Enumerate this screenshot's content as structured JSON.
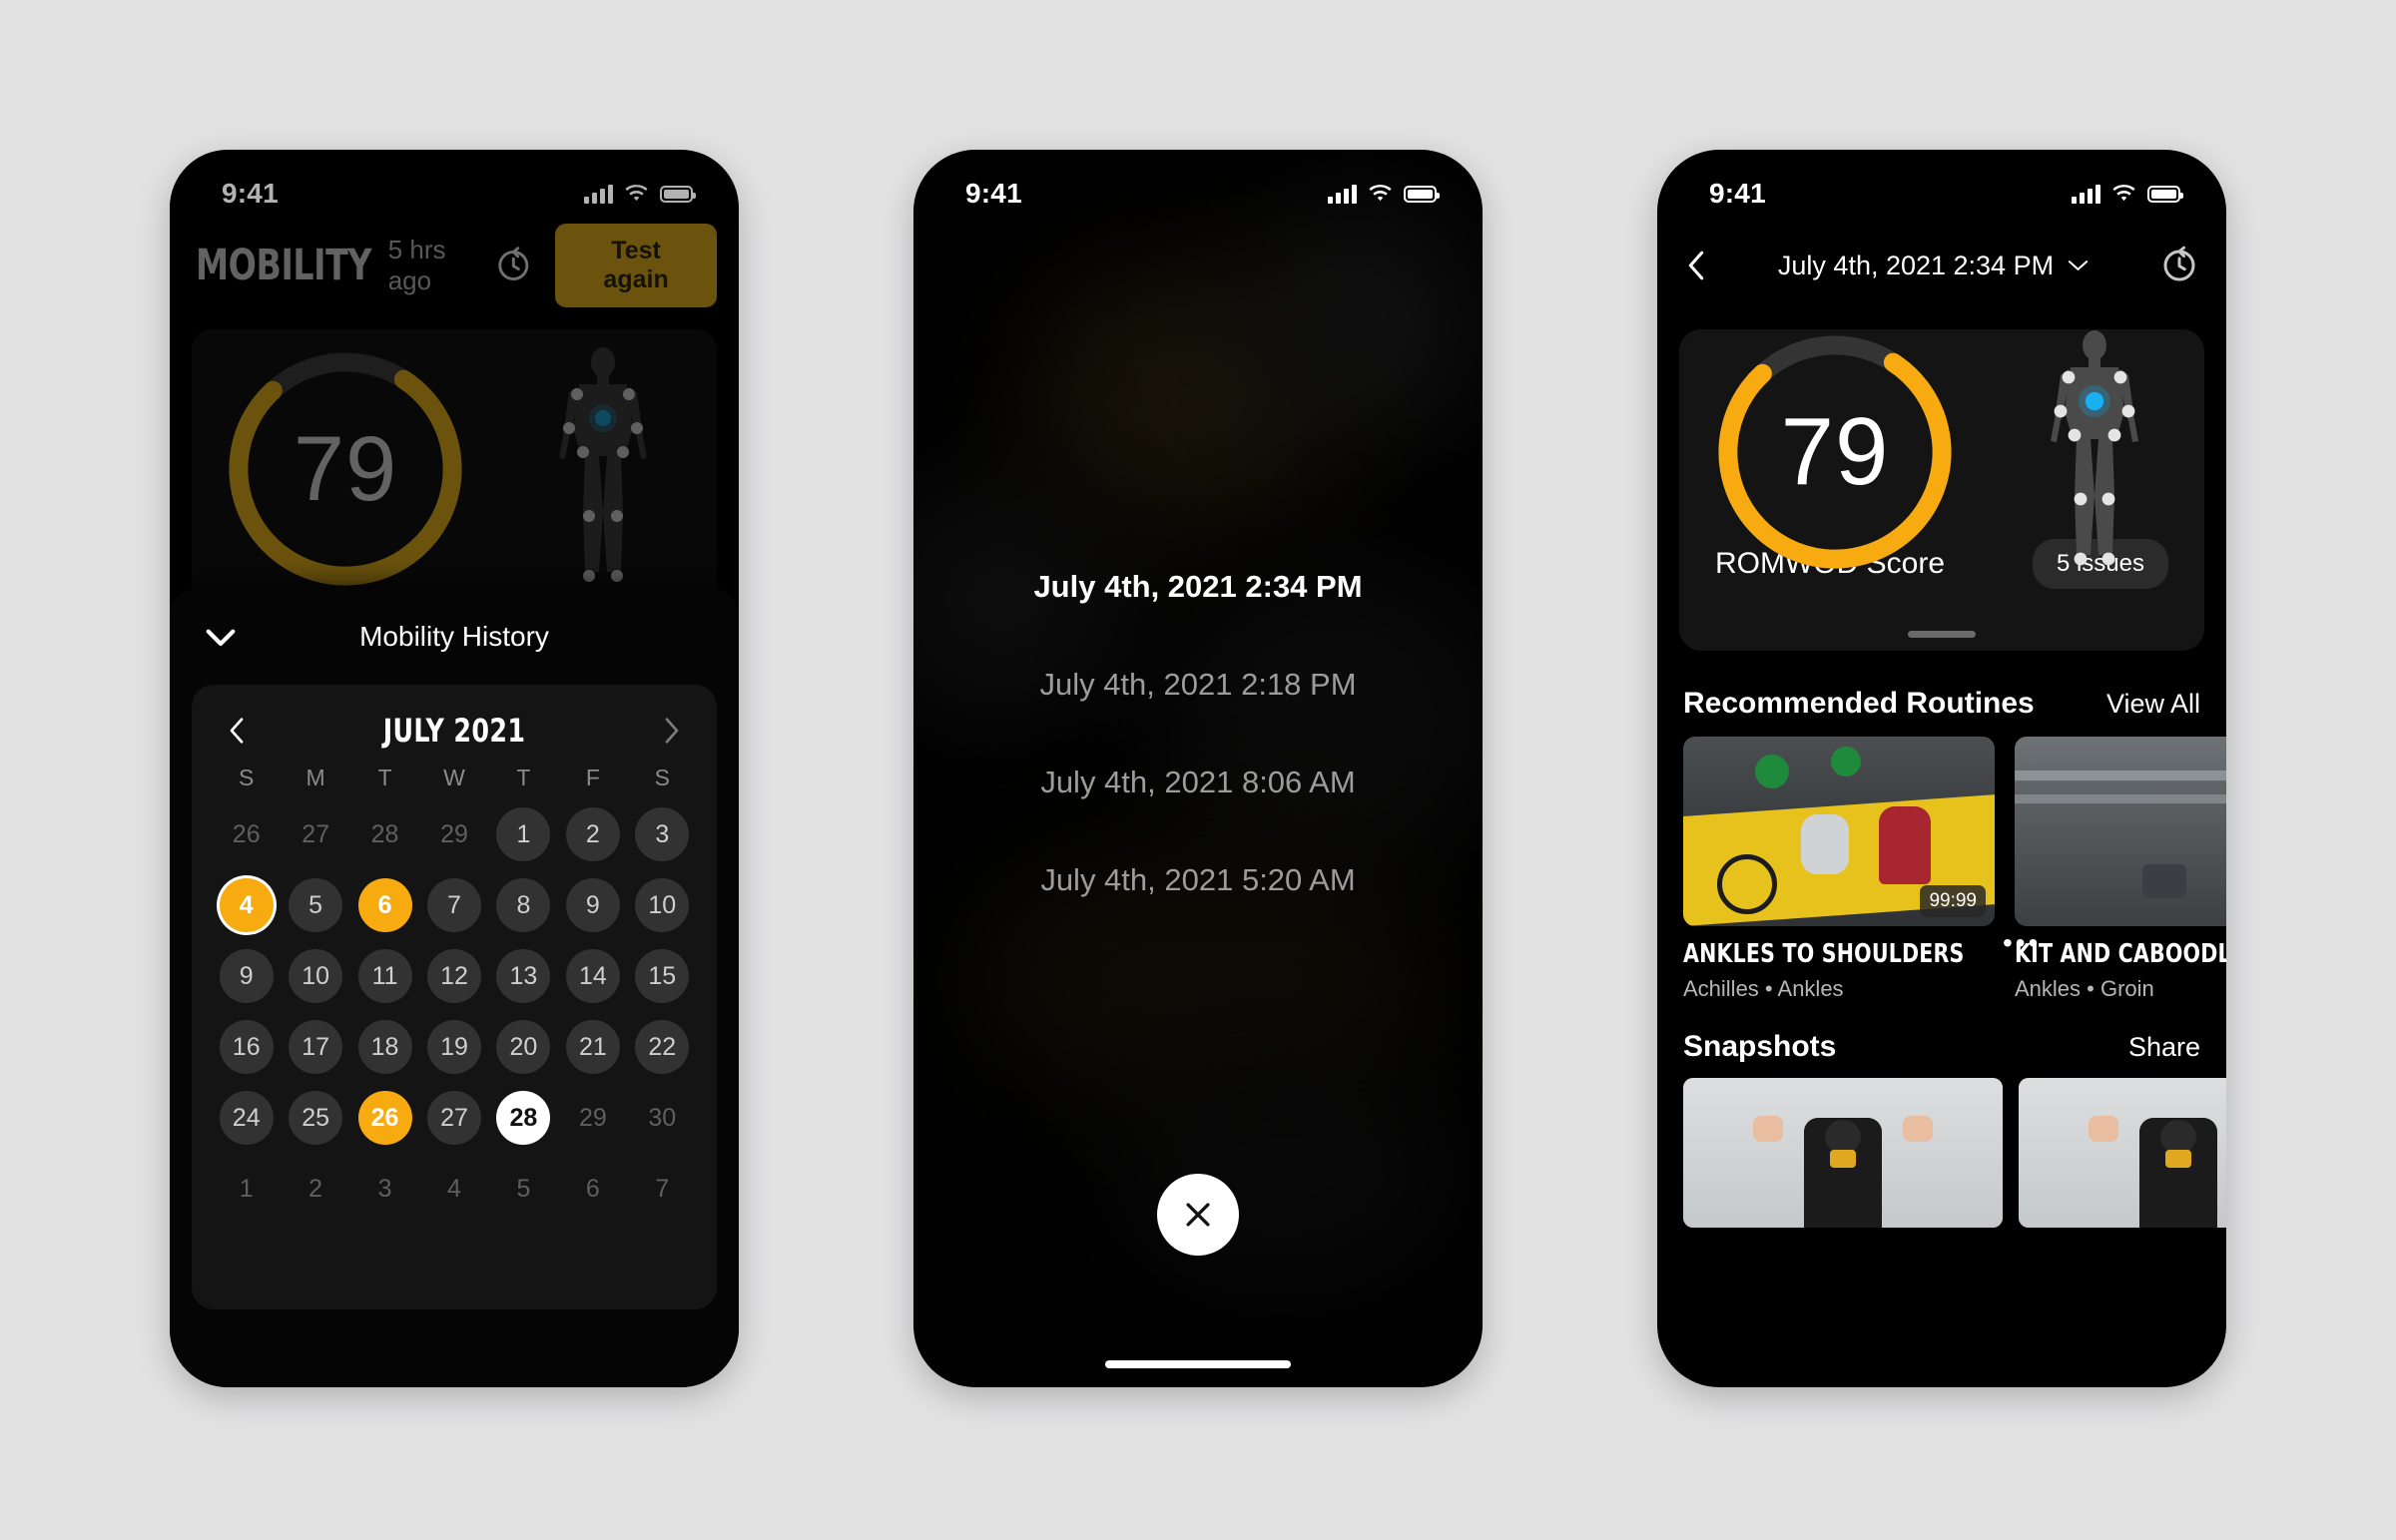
{
  "theme": {
    "accent_orange": "#f8ab10",
    "accent_dim_gold": "#9a7714",
    "card_bg": "#141414",
    "screen_bg": "#000000",
    "joint_blue": "#22a7dd"
  },
  "phone1": {
    "status": {
      "time": "9:41",
      "signal_icon": "cellular-signal-icon",
      "wifi_icon": "wifi-icon",
      "battery_icon": "battery-icon"
    },
    "header": {
      "title": "MOBILITY",
      "last_test": "5 hrs ago",
      "history_icon": "history-clock-icon",
      "test_again_label": "Test again"
    },
    "score_card": {
      "score": "79",
      "ring_percent": 79,
      "body_icon": "human-body-figure-icon"
    },
    "sheet": {
      "collapse_icon": "chevron-down-icon",
      "title": "Mobility History",
      "calendar": {
        "month_label": "JULY 2021",
        "prev_icon": "chevron-left-icon",
        "next_icon": "chevron-right-icon",
        "weekday_labels": [
          "S",
          "M",
          "T",
          "W",
          "T",
          "F",
          "S"
        ],
        "weeks": [
          [
            {
              "n": "26",
              "state": "muted"
            },
            {
              "n": "27",
              "state": "muted"
            },
            {
              "n": "28",
              "state": "muted"
            },
            {
              "n": "29",
              "state": "muted"
            },
            {
              "n": "1",
              "state": "plain"
            },
            {
              "n": "2",
              "state": "plain"
            },
            {
              "n": "3",
              "state": "plain"
            }
          ],
          [
            {
              "n": "4",
              "state": "selected"
            },
            {
              "n": "5",
              "state": "plain"
            },
            {
              "n": "6",
              "state": "active"
            },
            {
              "n": "7",
              "state": "plain"
            },
            {
              "n": "8",
              "state": "plain"
            },
            {
              "n": "9",
              "state": "plain"
            },
            {
              "n": "10",
              "state": "plain"
            }
          ],
          [
            {
              "n": "9",
              "state": "plain"
            },
            {
              "n": "10",
              "state": "plain"
            },
            {
              "n": "11",
              "state": "plain"
            },
            {
              "n": "12",
              "state": "plain"
            },
            {
              "n": "13",
              "state": "plain"
            },
            {
              "n": "14",
              "state": "plain"
            },
            {
              "n": "15",
              "state": "plain"
            }
          ],
          [
            {
              "n": "16",
              "state": "plain"
            },
            {
              "n": "17",
              "state": "plain"
            },
            {
              "n": "18",
              "state": "plain"
            },
            {
              "n": "19",
              "state": "plain"
            },
            {
              "n": "20",
              "state": "plain"
            },
            {
              "n": "21",
              "state": "plain"
            },
            {
              "n": "22",
              "state": "plain"
            }
          ],
          [
            {
              "n": "24",
              "state": "plain"
            },
            {
              "n": "25",
              "state": "plain"
            },
            {
              "n": "26",
              "state": "active"
            },
            {
              "n": "27",
              "state": "plain"
            },
            {
              "n": "28",
              "state": "today"
            },
            {
              "n": "29",
              "state": "muted"
            },
            {
              "n": "30",
              "state": "muted"
            }
          ],
          [
            {
              "n": "1",
              "state": "muted"
            },
            {
              "n": "2",
              "state": "muted"
            },
            {
              "n": "3",
              "state": "muted"
            },
            {
              "n": "4",
              "state": "muted"
            },
            {
              "n": "5",
              "state": "muted"
            },
            {
              "n": "6",
              "state": "muted"
            },
            {
              "n": "7",
              "state": "muted"
            }
          ]
        ]
      }
    }
  },
  "phone2": {
    "status": {
      "time": "9:41"
    },
    "picker": {
      "items": [
        {
          "label": "July 4th, 2021 2:34 PM",
          "selected": true
        },
        {
          "label": "July 4th, 2021 2:18 PM",
          "selected": false
        },
        {
          "label": "July 4th, 2021 8:06 AM",
          "selected": false
        },
        {
          "label": "July 4th, 2021 5:20 AM",
          "selected": false
        }
      ],
      "close_icon": "close-x-icon"
    }
  },
  "phone3": {
    "status": {
      "time": "9:41"
    },
    "nav": {
      "back_icon": "chevron-left-icon",
      "date_label": "July 4th, 2021 2:34 PM",
      "dropdown_icon": "chevron-down-icon",
      "history_icon": "history-clock-icon"
    },
    "score_card": {
      "score": "79",
      "ring_percent": 79,
      "label": "ROMWOD Score",
      "issues_badge": "5 issues",
      "body_icon": "human-body-figure-icon"
    },
    "routines": {
      "section_title": "Recommended Routines",
      "view_all_label": "View All",
      "cards": [
        {
          "title": "ANKLES TO SHOULDERS",
          "tags": "Achilles • Ankles",
          "duration": "99:99",
          "menu_icon": "more-options-icon"
        },
        {
          "title": "KIT AND CABOODLE",
          "tags": "Ankles • Groin",
          "duration": "",
          "menu_icon": "more-options-icon"
        }
      ]
    },
    "snapshots": {
      "section_title": "Snapshots",
      "share_label": "Share",
      "items": [
        "snapshot-1",
        "snapshot-2",
        "snapshot-3"
      ]
    }
  }
}
